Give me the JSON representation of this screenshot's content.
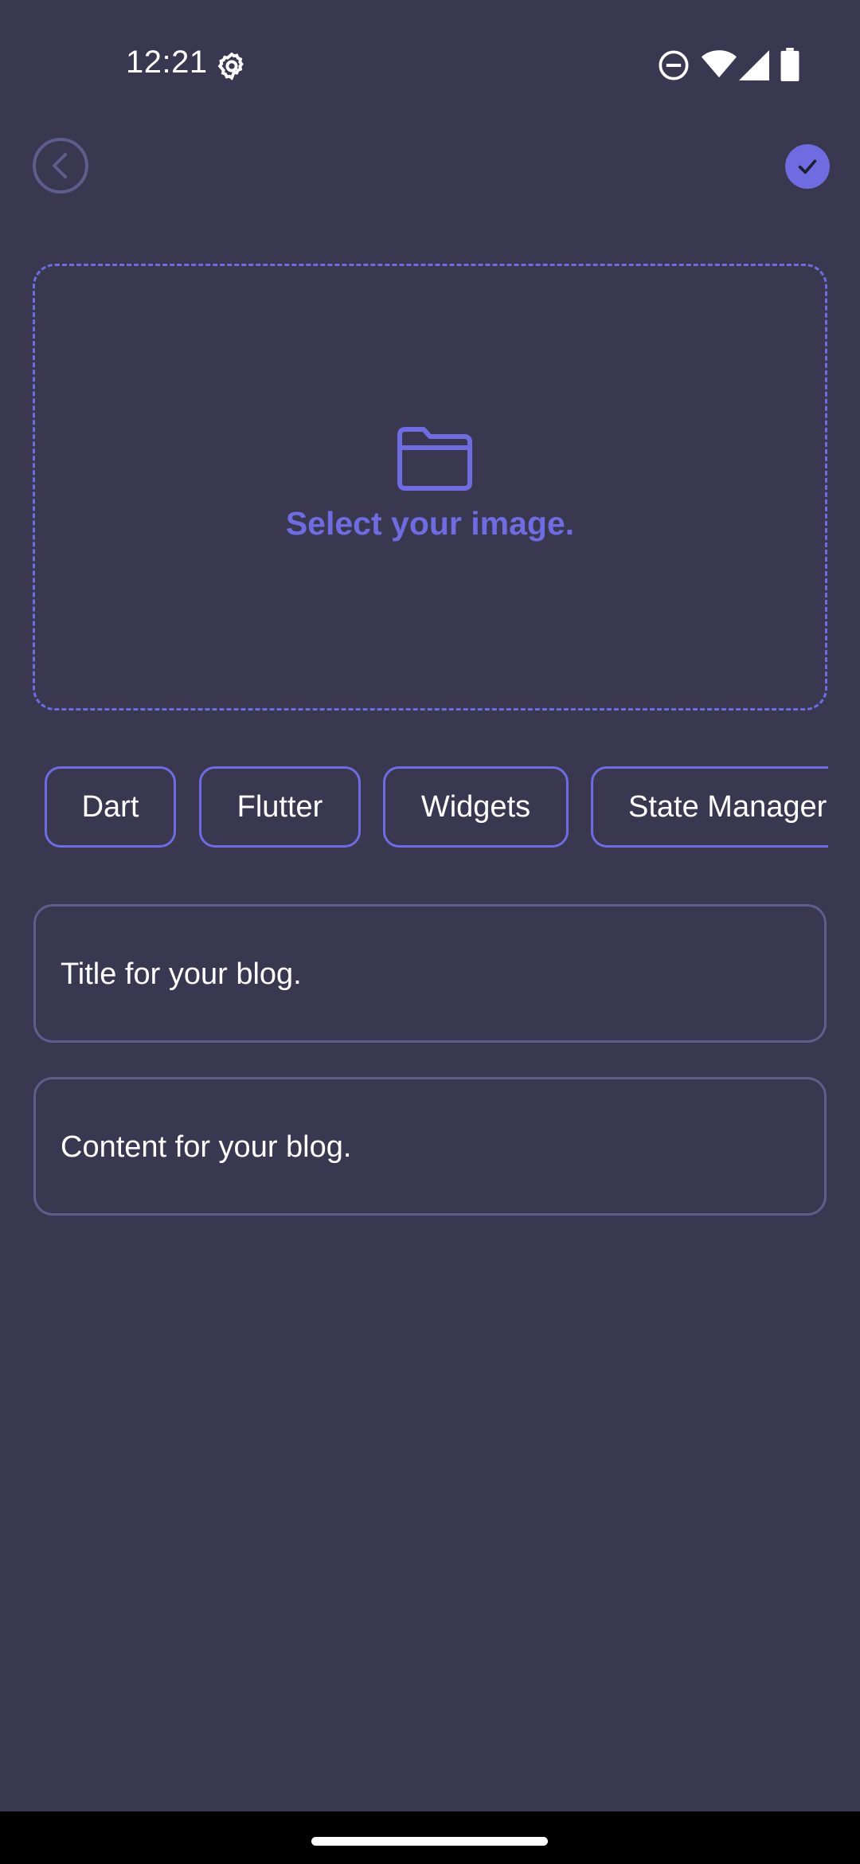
{
  "status_bar": {
    "time": "12:21",
    "icons": [
      "settings-gear-icon",
      "do-not-disturb-icon",
      "wifi-icon",
      "cell-signal-icon",
      "battery-icon"
    ]
  },
  "app_bar": {
    "back_icon": "chevron-left-circle-icon",
    "confirm_icon": "check-icon"
  },
  "image_picker": {
    "icon": "folder-icon",
    "label": "Select your image."
  },
  "tags": [
    {
      "label": "Dart"
    },
    {
      "label": "Flutter"
    },
    {
      "label": "Widgets"
    },
    {
      "label": "State Manager"
    }
  ],
  "form": {
    "title_placeholder": "Title for your blog.",
    "content_placeholder": "Content for your blog."
  },
  "colors": {
    "background": "#393850",
    "accent": "#6E6CE0",
    "field_border": "#5E5D8C",
    "back_icon": "#5E5D8C"
  }
}
